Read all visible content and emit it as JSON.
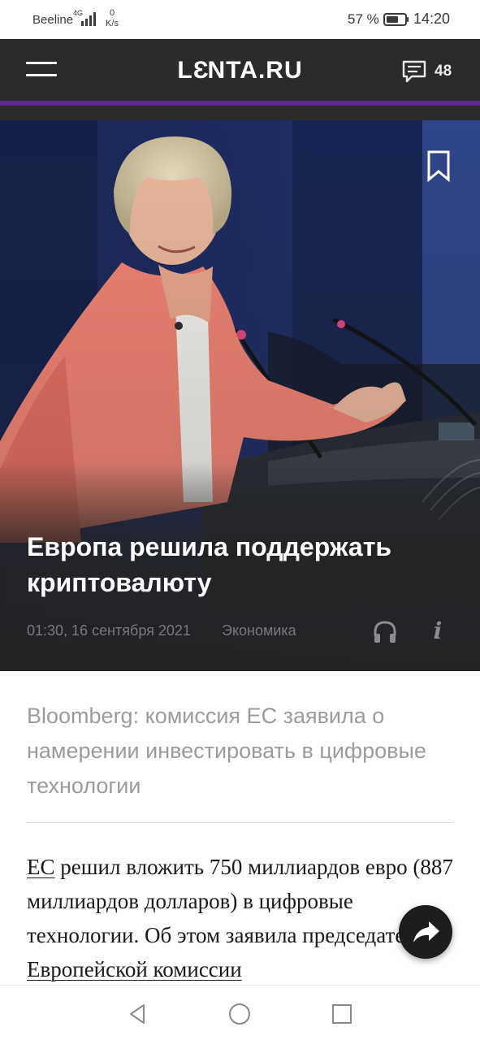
{
  "status_bar": {
    "carrier": "Beeline",
    "network": "4G",
    "data_speed_value": "0",
    "data_speed_unit": "K/s",
    "battery_percent": "57 %",
    "time": "14:20"
  },
  "header": {
    "logo": {
      "left": "L",
      "mid": "Ɛ",
      "right": "NTA.RU"
    },
    "comments_count": "48",
    "accent_color": "#5d2b86"
  },
  "article": {
    "title": "Европа решила поддержать криптовалюту",
    "date": "01:30, 16 сентября 2021",
    "rubric": "Экономика",
    "subtitle": "Bloomberg: комиссия ЕС заявила о намерении инвестировать в цифровые технологии",
    "body": {
      "link1": "ЕС",
      "text1": " решил вложить 750 миллиардов евро (887 миллиардов долларов) в цифровые технологии. Об этом заявила председатель ",
      "link2": "Европейской комиссии"
    }
  },
  "icons": {
    "menu": "menu-icon",
    "comments": "comment-icon",
    "bookmark": "bookmark-icon",
    "audio": "headphones-icon",
    "info": "info-icon",
    "share": "share-icon",
    "nav_back": "back-icon",
    "nav_home": "home-icon",
    "nav_recent": "recent-apps-icon"
  },
  "info_glyph": "i"
}
